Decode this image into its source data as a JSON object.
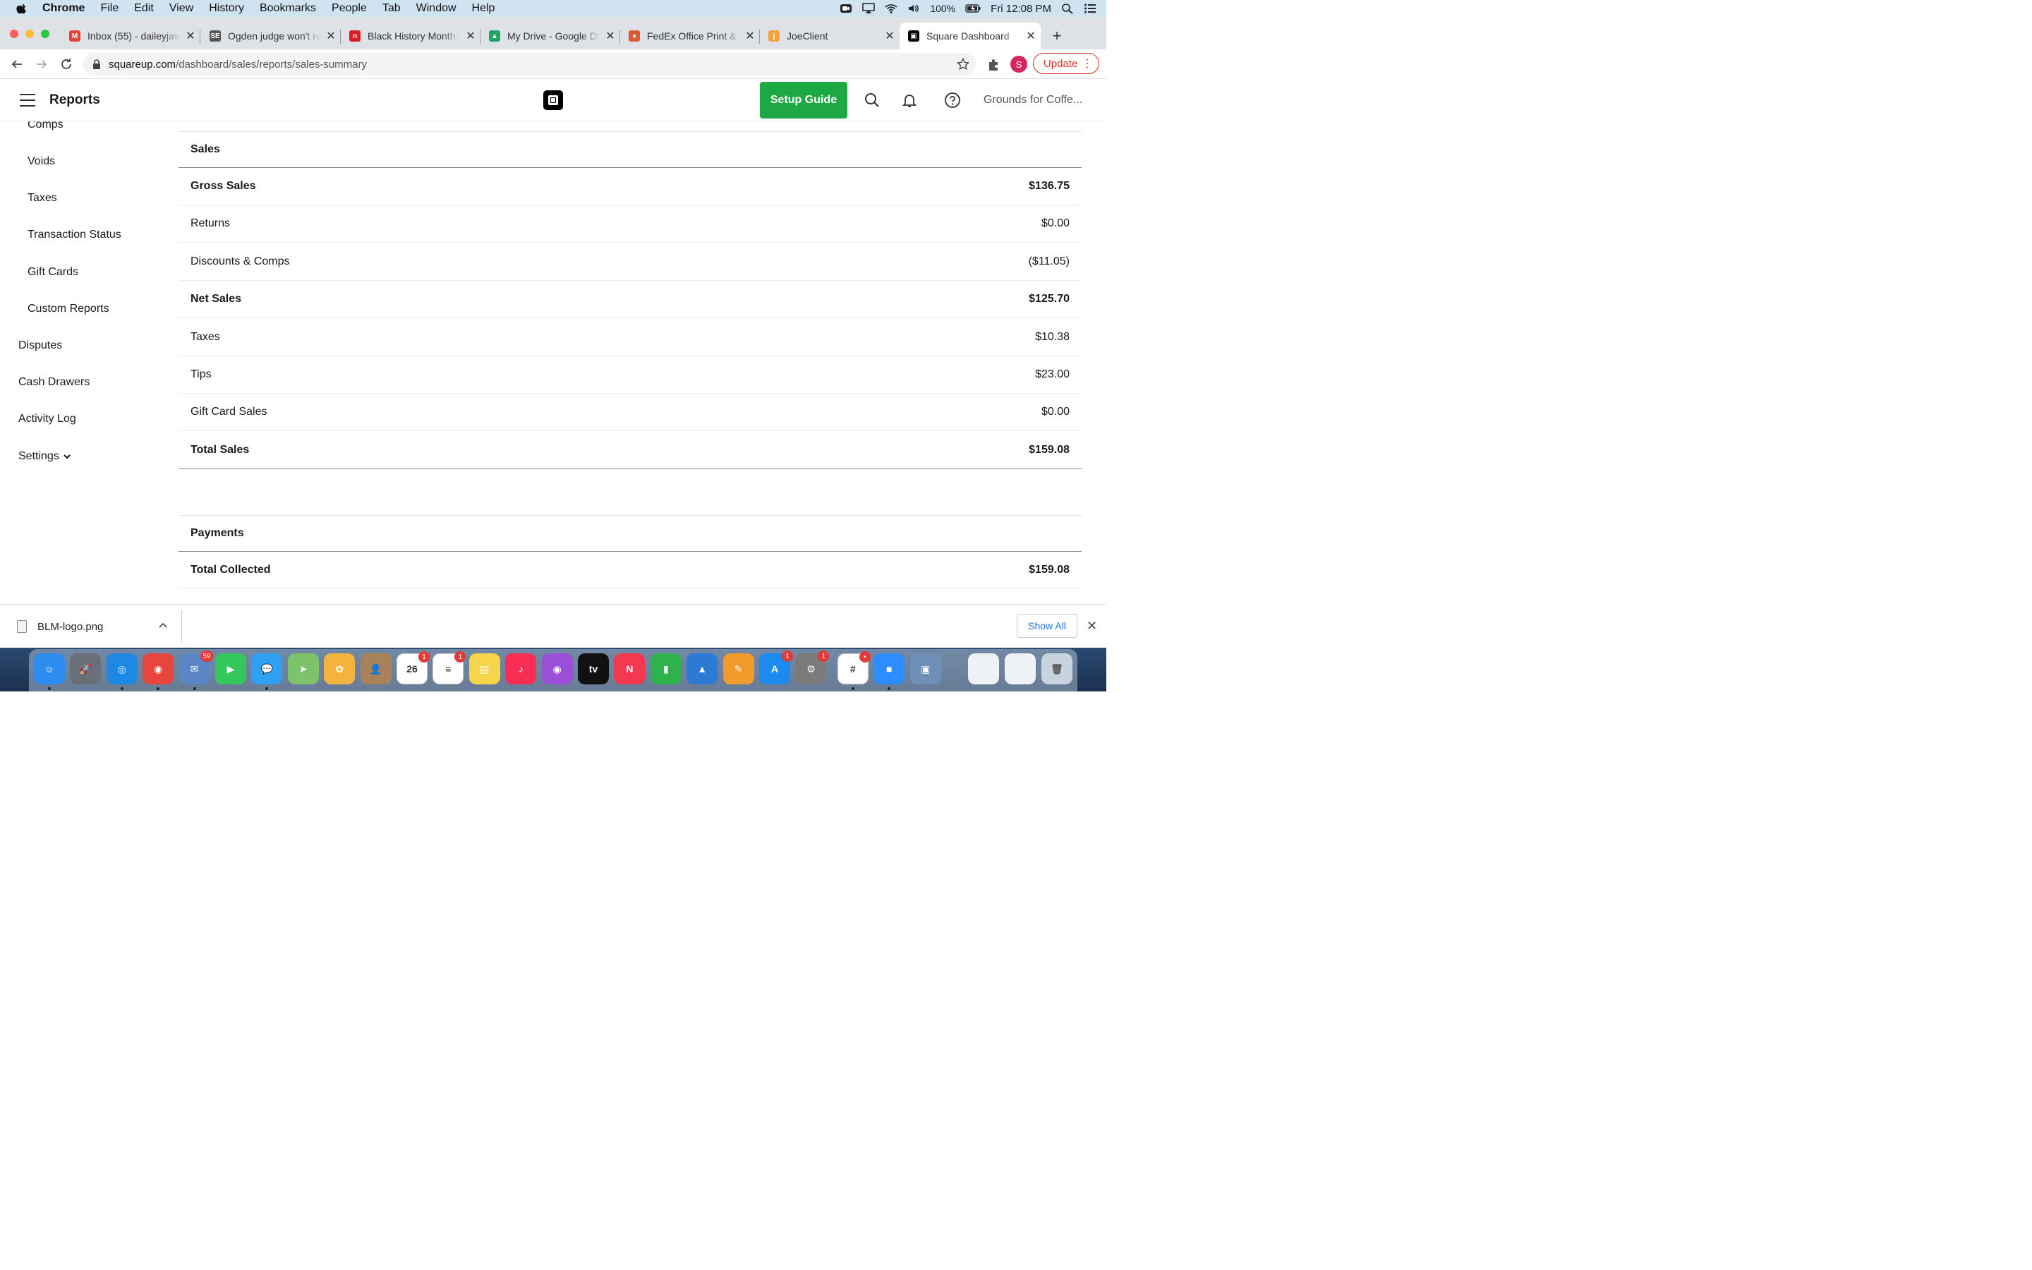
{
  "menubar": {
    "app": "Chrome",
    "items": [
      "File",
      "Edit",
      "View",
      "History",
      "Bookmarks",
      "People",
      "Tab",
      "Window",
      "Help"
    ],
    "battery": "100%",
    "clock": "Fri 12:08 PM"
  },
  "tabs": [
    {
      "title": "Inbox (55) - daileyjaw",
      "favicon": "gmail-icon",
      "color": "#ea4335",
      "glyph": "M"
    },
    {
      "title": "Ogden judge won't re",
      "favicon": "standard-examiner-icon",
      "color": "#555555",
      "glyph": "SE"
    },
    {
      "title": "Black History Month:",
      "favicon": "npr-icon",
      "color": "#d62021",
      "glyph": "n"
    },
    {
      "title": "My Drive - Google Dri",
      "favicon": "google-drive-icon",
      "color": "#1fa463",
      "glyph": "▲"
    },
    {
      "title": "FedEx Office Print &",
      "favicon": "duckduckgo-icon",
      "color": "#de5833",
      "glyph": "●"
    },
    {
      "title": "JoeClient",
      "favicon": "joeclient-icon",
      "color": "#f2a33a",
      "glyph": "j"
    },
    {
      "title": "Square Dashboard",
      "favicon": "square-icon",
      "color": "#000000",
      "glyph": "▣",
      "active": true
    }
  ],
  "address": {
    "host": "squareup.com",
    "path": "/dashboard/sales/reports/sales-summary"
  },
  "update_label": "Update",
  "profile_initial": "S",
  "header": {
    "title": "Reports",
    "setup_guide": "Setup Guide",
    "account": "Grounds for Coffe..."
  },
  "sidebar": {
    "sub_items": [
      "Comps",
      "Voids",
      "Taxes",
      "Transaction Status",
      "Gift Cards",
      "Custom Reports"
    ],
    "top_items": [
      "Disputes",
      "Cash Drawers",
      "Activity Log",
      "Settings"
    ]
  },
  "sales": {
    "heading": "Sales",
    "rows": [
      {
        "label": "Gross Sales",
        "value": "$136.75",
        "bold": true
      },
      {
        "label": "Returns",
        "value": "$0.00",
        "bold": false
      },
      {
        "label": "Discounts & Comps",
        "value": "($11.05)",
        "bold": false
      },
      {
        "label": "Net Sales",
        "value": "$125.70",
        "bold": true
      },
      {
        "label": "Taxes",
        "value": "$10.38",
        "bold": false
      },
      {
        "label": "Tips",
        "value": "$23.00",
        "bold": false
      },
      {
        "label": "Gift Card Sales",
        "value": "$0.00",
        "bold": false
      },
      {
        "label": "Total Sales",
        "value": "$159.08",
        "bold": true
      }
    ]
  },
  "payments": {
    "heading": "Payments",
    "rows": [
      {
        "label": "Total Collected",
        "value": "$159.08",
        "bold": true
      }
    ]
  },
  "download": {
    "filename": "BLM-logo.png",
    "show_all": "Show All"
  },
  "dock": [
    {
      "name": "finder",
      "color": "#2d8cf0",
      "glyph": "☺"
    },
    {
      "name": "launchpad",
      "color": "#6b6f7a",
      "glyph": "🚀"
    },
    {
      "name": "safari",
      "color": "#1e88e5",
      "glyph": "◎"
    },
    {
      "name": "chrome",
      "color": "#e8453c",
      "glyph": "◉"
    },
    {
      "name": "mail",
      "color": "#5a86c5",
      "glyph": "✉",
      "badge": "59"
    },
    {
      "name": "facetime",
      "color": "#34c759",
      "glyph": "▶"
    },
    {
      "name": "messages",
      "color": "#2fa0f2",
      "glyph": "💬"
    },
    {
      "name": "maps",
      "color": "#7cc36b",
      "glyph": "➤"
    },
    {
      "name": "photos",
      "color": "#f4b33d",
      "glyph": "✿"
    },
    {
      "name": "contacts",
      "color": "#a9825a",
      "glyph": "👤"
    },
    {
      "name": "calendar",
      "color": "#ffffff",
      "glyph": "26",
      "badge": "1"
    },
    {
      "name": "reminders",
      "color": "#ffffff",
      "glyph": "≡",
      "badge": "1"
    },
    {
      "name": "notes",
      "color": "#f7d54a",
      "glyph": "▤"
    },
    {
      "name": "music",
      "color": "#fa2d55",
      "glyph": "♪"
    },
    {
      "name": "podcasts",
      "color": "#9b4fd6",
      "glyph": "◉"
    },
    {
      "name": "apple-tv",
      "color": "#111111",
      "glyph": "tv"
    },
    {
      "name": "news",
      "color": "#f5384f",
      "glyph": "N"
    },
    {
      "name": "numbers",
      "color": "#2fb24c",
      "glyph": "▮"
    },
    {
      "name": "keynote",
      "color": "#2d7ad6",
      "glyph": "▲"
    },
    {
      "name": "pages",
      "color": "#f19b2c",
      "glyph": "✎"
    },
    {
      "name": "app-store",
      "color": "#1a8cf0",
      "glyph": "A",
      "badge": "1"
    },
    {
      "name": "system-preferences",
      "color": "#7b7b7b",
      "glyph": "⚙",
      "badge": "1"
    },
    {
      "name": "slack",
      "color": "#ffffff",
      "glyph": "#",
      "badge": "•"
    },
    {
      "name": "zoom",
      "color": "#2d8cff",
      "glyph": "■"
    },
    {
      "name": "preview",
      "color": "#6e8fb8",
      "glyph": "▣"
    }
  ]
}
